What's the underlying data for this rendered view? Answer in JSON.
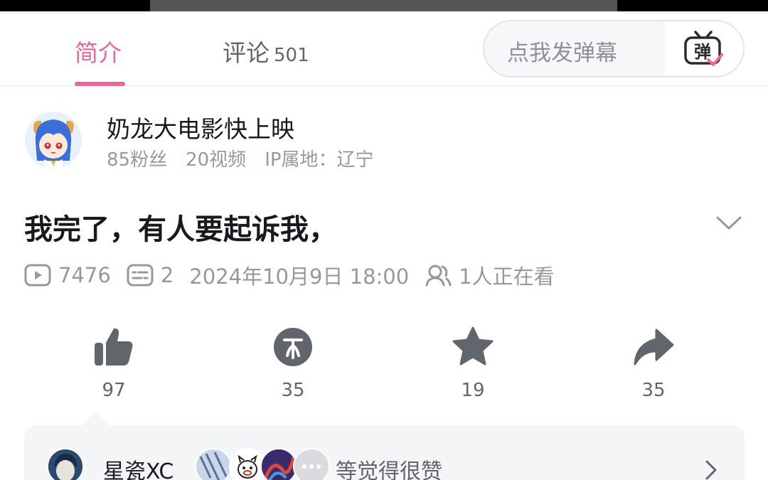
{
  "tabs": {
    "intro_label": "简介",
    "comments_label": "评论",
    "comments_count": "501"
  },
  "danmaku": {
    "placeholder": "点我发弹幕",
    "button_glyph": "弹"
  },
  "author": {
    "name": "奶龙大电影快上映",
    "fans": "85粉丝",
    "videos": "20视频",
    "ip_location": "IP属地：辽宁"
  },
  "video": {
    "title": "我完了，有人要起诉我，",
    "views": "7476",
    "danmaku_count": "2",
    "publish_time": "2024年10月9日 18:00",
    "watching_now": "1人正在看"
  },
  "actions": {
    "like_count": "97",
    "coin_count": "35",
    "favorite_count": "19",
    "share_count": "35"
  },
  "likers": {
    "first_name": "星瓷XC",
    "summary_text": "等觉得很赞"
  },
  "colors": {
    "accent_pink": "#e86a9a",
    "icon_gray": "#61666d",
    "meta_gray": "#9499a0"
  },
  "icons": [
    "play-icon",
    "danmaku-list-icon",
    "viewers-icon",
    "chevron-down-icon",
    "like-icon",
    "coin-icon",
    "star-icon",
    "share-icon",
    "chevron-right-icon",
    "danmaku-tv-icon"
  ]
}
